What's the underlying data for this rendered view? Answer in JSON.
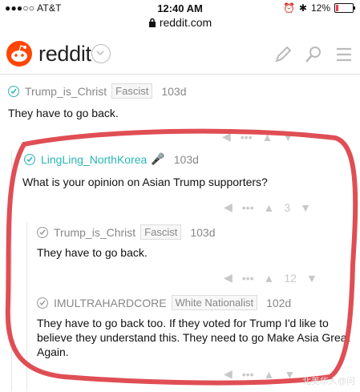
{
  "status_bar": {
    "carrier": "●●●○○ AT&T",
    "time": "12:40 AM",
    "battery": "12%",
    "battery_level": 0.12
  },
  "browser": {
    "url": "reddit.com"
  },
  "app": {
    "brand": "reddit"
  },
  "comments": [
    {
      "user": "Trump_is_Christ",
      "flair": "Fascist",
      "age": "103d",
      "body": "They have to go back.",
      "score": ""
    },
    {
      "user": "LingLing_NorthKorea",
      "flair": "",
      "age": "103d",
      "body": "What is your opinion on Asian Trump supporters?",
      "score": "3"
    },
    {
      "user": "Trump_is_Christ",
      "flair": "Fascist",
      "age": "103d",
      "body": "They have to go back.",
      "score": "12"
    },
    {
      "user": "IMULTRAHARDCORE",
      "flair": "White Nationalist",
      "age": "102d",
      "body": "They have to go back too. If they voted for Trump I'd like to believe they understand this. They need to go Make Asia Great Again.",
      "score": ""
    }
  ],
  "watermark": "北美华人@问",
  "colors": {
    "brand": "#ff4500",
    "teal_user": "#2bb5b5",
    "annotation": "#e04e55"
  }
}
